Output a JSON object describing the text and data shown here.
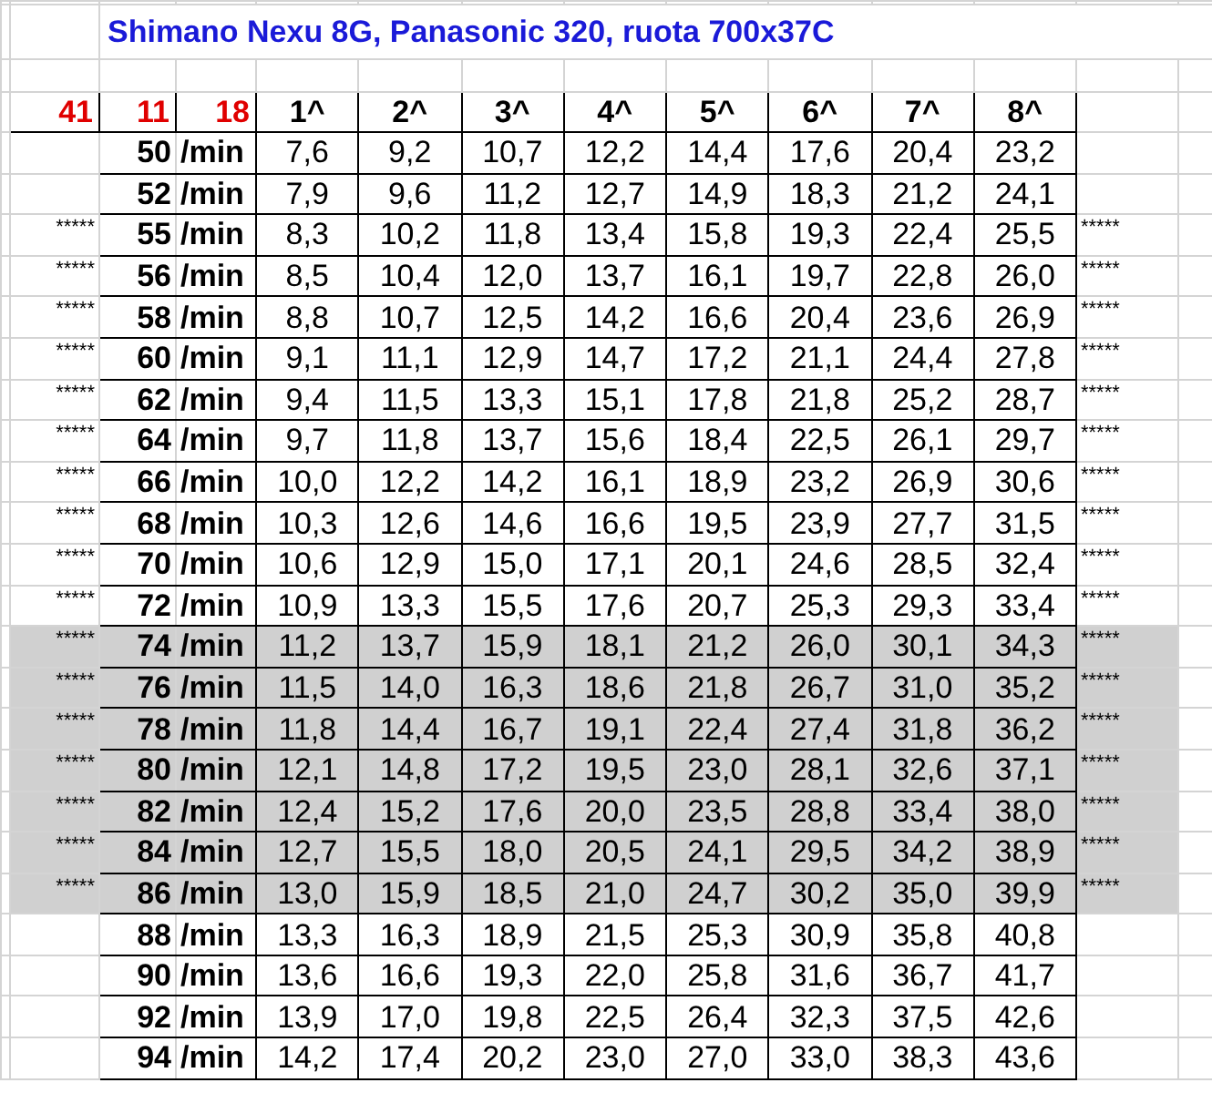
{
  "title": "Shimano Nexu 8G, Panasonic 320, ruota 700x37C",
  "header": {
    "inputs": [
      "41",
      "11",
      "18"
    ],
    "gears": [
      "1^",
      "2^",
      "3^",
      "4^",
      "5^",
      "6^",
      "7^",
      "8^"
    ]
  },
  "rows": [
    {
      "cadence": "50",
      "unit": "/min",
      "speeds": [
        "7,6",
        "9,2",
        "10,7",
        "12,2",
        "14,4",
        "17,6",
        "20,4",
        "23,2"
      ],
      "highlighted": false
    },
    {
      "cadence": "52",
      "unit": "/min",
      "speeds": [
        "7,9",
        "9,6",
        "11,2",
        "12,7",
        "14,9",
        "18,3",
        "21,2",
        "24,1"
      ],
      "highlighted": false
    },
    {
      "cadence": "55",
      "unit": "/min",
      "speeds": [
        "8,3",
        "10,2",
        "11,8",
        "13,4",
        "15,8",
        "19,3",
        "22,4",
        "25,5"
      ],
      "marker_left": "*****",
      "marker_right": "*****",
      "highlighted": false
    },
    {
      "cadence": "56",
      "unit": "/min",
      "speeds": [
        "8,5",
        "10,4",
        "12,0",
        "13,7",
        "16,1",
        "19,7",
        "22,8",
        "26,0"
      ],
      "marker_left": "*****",
      "marker_right": "*****",
      "highlighted": false
    },
    {
      "cadence": "58",
      "unit": "/min",
      "speeds": [
        "8,8",
        "10,7",
        "12,5",
        "14,2",
        "16,6",
        "20,4",
        "23,6",
        "26,9"
      ],
      "marker_left": "*****",
      "marker_right": "*****",
      "highlighted": false
    },
    {
      "cadence": "60",
      "unit": "/min",
      "speeds": [
        "9,1",
        "11,1",
        "12,9",
        "14,7",
        "17,2",
        "21,1",
        "24,4",
        "27,8"
      ],
      "marker_left": "*****",
      "marker_right": "*****",
      "highlighted": false
    },
    {
      "cadence": "62",
      "unit": "/min",
      "speeds": [
        "9,4",
        "11,5",
        "13,3",
        "15,1",
        "17,8",
        "21,8",
        "25,2",
        "28,7"
      ],
      "marker_left": "*****",
      "marker_right": "*****",
      "highlighted": false
    },
    {
      "cadence": "64",
      "unit": "/min",
      "speeds": [
        "9,7",
        "11,8",
        "13,7",
        "15,6",
        "18,4",
        "22,5",
        "26,1",
        "29,7"
      ],
      "marker_left": "*****",
      "marker_right": "*****",
      "highlighted": false
    },
    {
      "cadence": "66",
      "unit": "/min",
      "speeds": [
        "10,0",
        "12,2",
        "14,2",
        "16,1",
        "18,9",
        "23,2",
        "26,9",
        "30,6"
      ],
      "marker_left": "*****",
      "marker_right": "*****",
      "highlighted": false
    },
    {
      "cadence": "68",
      "unit": "/min",
      "speeds": [
        "10,3",
        "12,6",
        "14,6",
        "16,6",
        "19,5",
        "23,9",
        "27,7",
        "31,5"
      ],
      "marker_left": "*****",
      "marker_right": "*****",
      "highlighted": false
    },
    {
      "cadence": "70",
      "unit": "/min",
      "speeds": [
        "10,6",
        "12,9",
        "15,0",
        "17,1",
        "20,1",
        "24,6",
        "28,5",
        "32,4"
      ],
      "marker_left": "*****",
      "marker_right": "*****",
      "highlighted": false
    },
    {
      "cadence": "72",
      "unit": "/min",
      "speeds": [
        "10,9",
        "13,3",
        "15,5",
        "17,6",
        "20,7",
        "25,3",
        "29,3",
        "33,4"
      ],
      "marker_left": "*****",
      "marker_right": "*****",
      "highlighted": false
    },
    {
      "cadence": "74",
      "unit": "/min",
      "speeds": [
        "11,2",
        "13,7",
        "15,9",
        "18,1",
        "21,2",
        "26,0",
        "30,1",
        "34,3"
      ],
      "marker_left": "*****",
      "marker_right": "*****",
      "highlighted": true
    },
    {
      "cadence": "76",
      "unit": "/min",
      "speeds": [
        "11,5",
        "14,0",
        "16,3",
        "18,6",
        "21,8",
        "26,7",
        "31,0",
        "35,2"
      ],
      "marker_left": "*****",
      "marker_right": "*****",
      "highlighted": true
    },
    {
      "cadence": "78",
      "unit": "/min",
      "speeds": [
        "11,8",
        "14,4",
        "16,7",
        "19,1",
        "22,4",
        "27,4",
        "31,8",
        "36,2"
      ],
      "marker_left": "*****",
      "marker_right": "*****",
      "highlighted": true
    },
    {
      "cadence": "80",
      "unit": "/min",
      "speeds": [
        "12,1",
        "14,8",
        "17,2",
        "19,5",
        "23,0",
        "28,1",
        "32,6",
        "37,1"
      ],
      "marker_left": "*****",
      "marker_right": "*****",
      "highlighted": true
    },
    {
      "cadence": "82",
      "unit": "/min",
      "speeds": [
        "12,4",
        "15,2",
        "17,6",
        "20,0",
        "23,5",
        "28,8",
        "33,4",
        "38,0"
      ],
      "marker_left": "*****",
      "marker_right": "*****",
      "highlighted": true
    },
    {
      "cadence": "84",
      "unit": "/min",
      "speeds": [
        "12,7",
        "15,5",
        "18,0",
        "20,5",
        "24,1",
        "29,5",
        "34,2",
        "38,9"
      ],
      "marker_left": "*****",
      "marker_right": "*****",
      "highlighted": true
    },
    {
      "cadence": "86",
      "unit": "/min",
      "speeds": [
        "13,0",
        "15,9",
        "18,5",
        "21,0",
        "24,7",
        "30,2",
        "35,0",
        "39,9"
      ],
      "marker_left": "*****",
      "marker_right": "*****",
      "highlighted": true
    },
    {
      "cadence": "88",
      "unit": "/min",
      "speeds": [
        "13,3",
        "16,3",
        "18,9",
        "21,5",
        "25,3",
        "30,9",
        "35,8",
        "40,8"
      ],
      "highlighted": false
    },
    {
      "cadence": "90",
      "unit": "/min",
      "speeds": [
        "13,6",
        "16,6",
        "19,3",
        "22,0",
        "25,8",
        "31,6",
        "36,7",
        "41,7"
      ],
      "highlighted": false
    },
    {
      "cadence": "92",
      "unit": "/min",
      "speeds": [
        "13,9",
        "17,0",
        "19,8",
        "22,5",
        "26,4",
        "32,3",
        "37,5",
        "42,6"
      ],
      "highlighted": false
    },
    {
      "cadence": "94",
      "unit": "/min",
      "speeds": [
        "14,2",
        "17,4",
        "20,2",
        "23,0",
        "27,0",
        "33,0",
        "38,3",
        "43,6"
      ],
      "highlighted": false
    }
  ]
}
